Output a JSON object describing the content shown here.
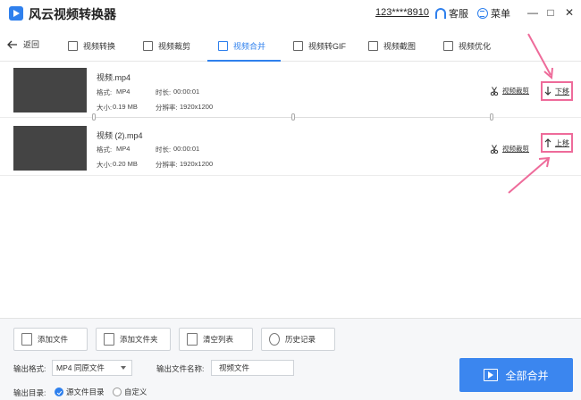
{
  "app": {
    "title": "风云视频转换器",
    "account": "123****8910",
    "service_label": "客服",
    "menu_label": "菜单",
    "window_buttons": [
      "—",
      "□",
      "✕"
    ]
  },
  "nav": {
    "back_label": "返回",
    "tabs": [
      {
        "label": "视频转换",
        "icon": "video-convert-icon",
        "active": false
      },
      {
        "label": "视频裁剪",
        "icon": "video-crop-icon",
        "active": false
      },
      {
        "label": "视频合并",
        "icon": "video-merge-icon",
        "active": true
      },
      {
        "label": "视频转GIF",
        "icon": "gif-icon",
        "active": false
      },
      {
        "label": "视频截图",
        "icon": "screenshot-icon",
        "active": false
      },
      {
        "label": "视频优化",
        "icon": "optimize-icon",
        "active": false
      }
    ]
  },
  "files": [
    {
      "name": "视频.mp4",
      "format_label": "格式:",
      "format": "MP4",
      "duration_label": "时长:",
      "duration": "00:00:01",
      "size_label": "大小:",
      "size": "0.19 MB",
      "resolution_label": "分辨率:",
      "resolution": "1920x1200",
      "cut_label": "视频裁剪",
      "move_label": "下移"
    },
    {
      "name": "视频 (2).mp4",
      "format_label": "格式:",
      "format": "MP4",
      "duration_label": "时长:",
      "duration": "00:00:01",
      "size_label": "大小:",
      "size": "0.20 MB",
      "resolution_label": "分辨率:",
      "resolution": "1920x1200",
      "cut_label": "视频裁剪",
      "move_label": "上移"
    }
  ],
  "bottom": {
    "buttons": {
      "add_file": "添加文件",
      "add_folder": "添加文件夹",
      "clear_list": "清空列表",
      "history": "历史记录"
    },
    "output_format_label": "输出格式:",
    "output_format_value": "MP4 同原文件",
    "output_name_label": "输出文件名称:",
    "output_name_value": "视频文件",
    "output_dir_label": "输出目录:",
    "dir_options": [
      {
        "label": "源文件目录",
        "selected": true
      },
      {
        "label": "自定义",
        "selected": false
      }
    ],
    "merge_all_label": "全部合并"
  },
  "colors": {
    "accent": "#2f80ed",
    "merge_button": "#3b86ef",
    "annotation": "#ee6b9a",
    "thumbnail": "#444444"
  }
}
